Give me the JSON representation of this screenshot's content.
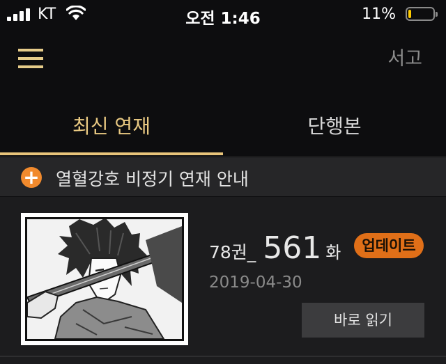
{
  "status_bar": {
    "carrier": "KT",
    "time": "오전 1:46",
    "battery_percent": "11%",
    "battery_level": 0.11,
    "icons": [
      "signal-bars-icon",
      "wifi-icon",
      "battery-icon"
    ]
  },
  "header": {
    "menu_icon": "hamburger-menu-icon",
    "library_label": "서고"
  },
  "tabs": [
    {
      "label": "최신 연재",
      "selected": true
    },
    {
      "label": "단행본",
      "selected": false
    }
  ],
  "notice": {
    "icon": "plus-circle-icon",
    "text": "열혈강호 비정기 연재 안내"
  },
  "episode": {
    "volume": "78권_",
    "number": "561",
    "unit": "화",
    "badge": "업데이트",
    "date": "2019-04-30",
    "read_button": "바로 읽기"
  },
  "colors": {
    "accent_gold": "#e8c47a",
    "badge_orange": "#e06f18",
    "plus_orange": "#f18a2d",
    "background": "#0d0d0f"
  }
}
